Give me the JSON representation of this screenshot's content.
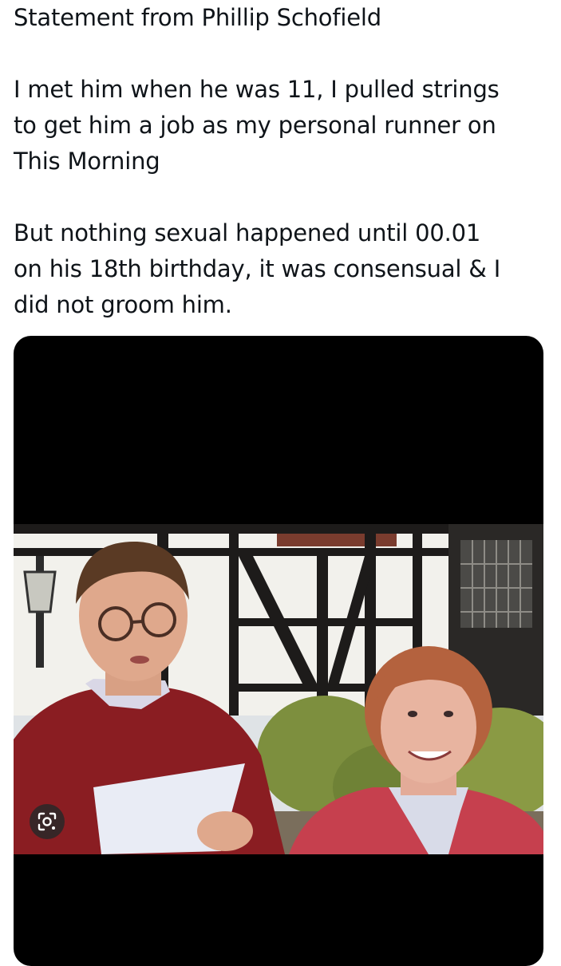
{
  "tweet": {
    "lines_p1": [
      "Statement from Phillip Schofield"
    ],
    "lines_p2": [
      "I met him when he was 11, I pulled strings",
      "to get him a job as my personal runner on",
      "This Morning"
    ],
    "lines_p3": [
      "But nothing sexual happened until 00.01",
      "on his 18th birthday, it was consensual & I",
      "did not groom him."
    ]
  },
  "media": {
    "icon": "lens-scan-icon",
    "colors": {
      "card_background": "#000000",
      "sweater_red": "#8a1d22",
      "cardigan_red": "#c6404e"
    }
  }
}
